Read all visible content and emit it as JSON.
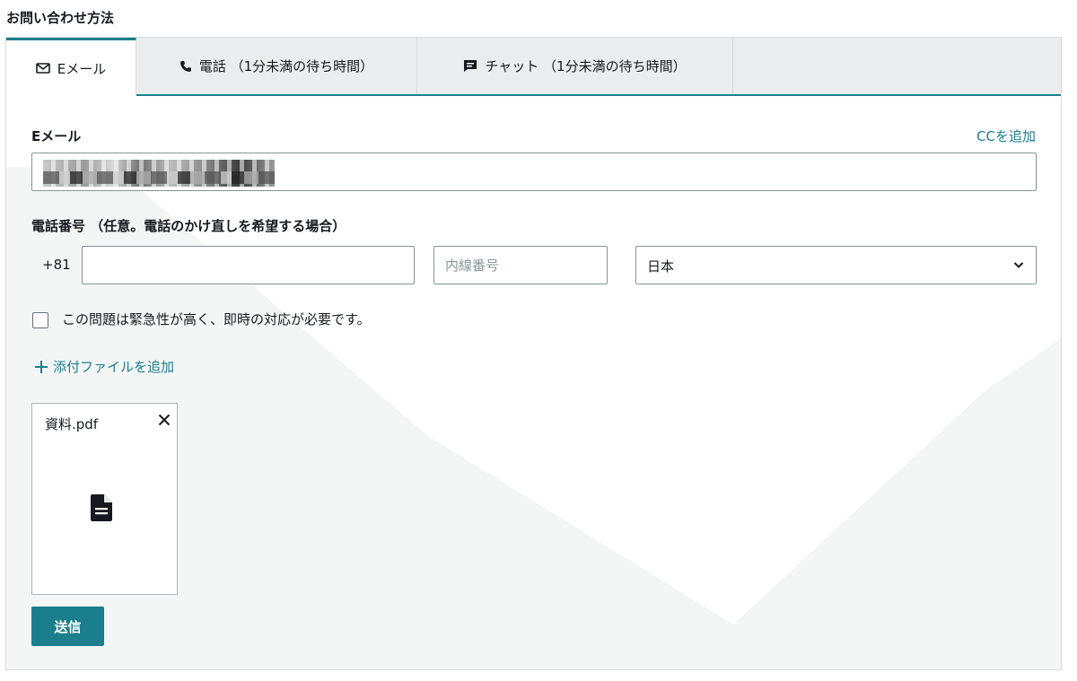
{
  "section_title": "お問い合わせ方法",
  "tabs": [
    {
      "label": "Eメール",
      "icon": "mail-icon"
    },
    {
      "label": "電話 （1分未満の待ち時間）",
      "icon": "phone-icon"
    },
    {
      "label": "チャット （1分未満の待ち時間）",
      "icon": "chat-icon"
    }
  ],
  "active_tab": "Eメール",
  "email": {
    "label": "Eメール",
    "add_cc": "CCを追加",
    "value": ""
  },
  "phone": {
    "label": "電話番号 （任意。電話のかけ直しを希望する場合）",
    "prefix": "+81",
    "number_value": "",
    "extension_placeholder": "内線番号",
    "country": "日本"
  },
  "urgent": {
    "label": "この問題は緊急性が高く、即時の対応が必要です。",
    "checked": false
  },
  "add_attachment": "添付ファイルを追加",
  "attachments": [
    {
      "name": "資料.pdf"
    }
  ],
  "submit_label": "送信",
  "colors": {
    "accent": "#1b7e8c",
    "border": "#879596",
    "tab_bg": "#eaeded"
  }
}
